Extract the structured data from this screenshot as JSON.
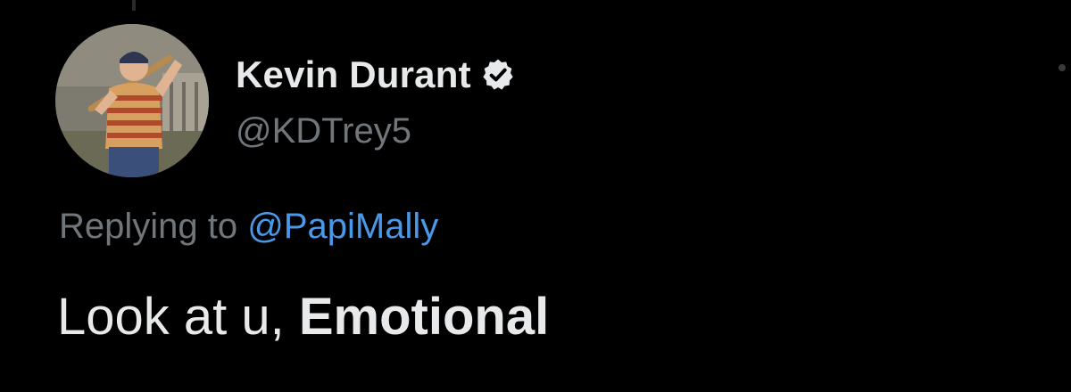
{
  "author": {
    "display_name": "Kevin Durant",
    "handle": "@KDTrey5",
    "verified": true,
    "verified_icon": "verified-badge-icon",
    "avatar_icon": "profile-photo"
  },
  "reply": {
    "prefix": "Replying to",
    "mention": "@PapiMally"
  },
  "tweet": {
    "text_plain": "Look at u,",
    "text_bold": "Emotional"
  },
  "colors": {
    "background": "#000000",
    "primary_text": "#e7e9ea",
    "secondary_text": "#71767b",
    "link": "#4a99e9"
  }
}
